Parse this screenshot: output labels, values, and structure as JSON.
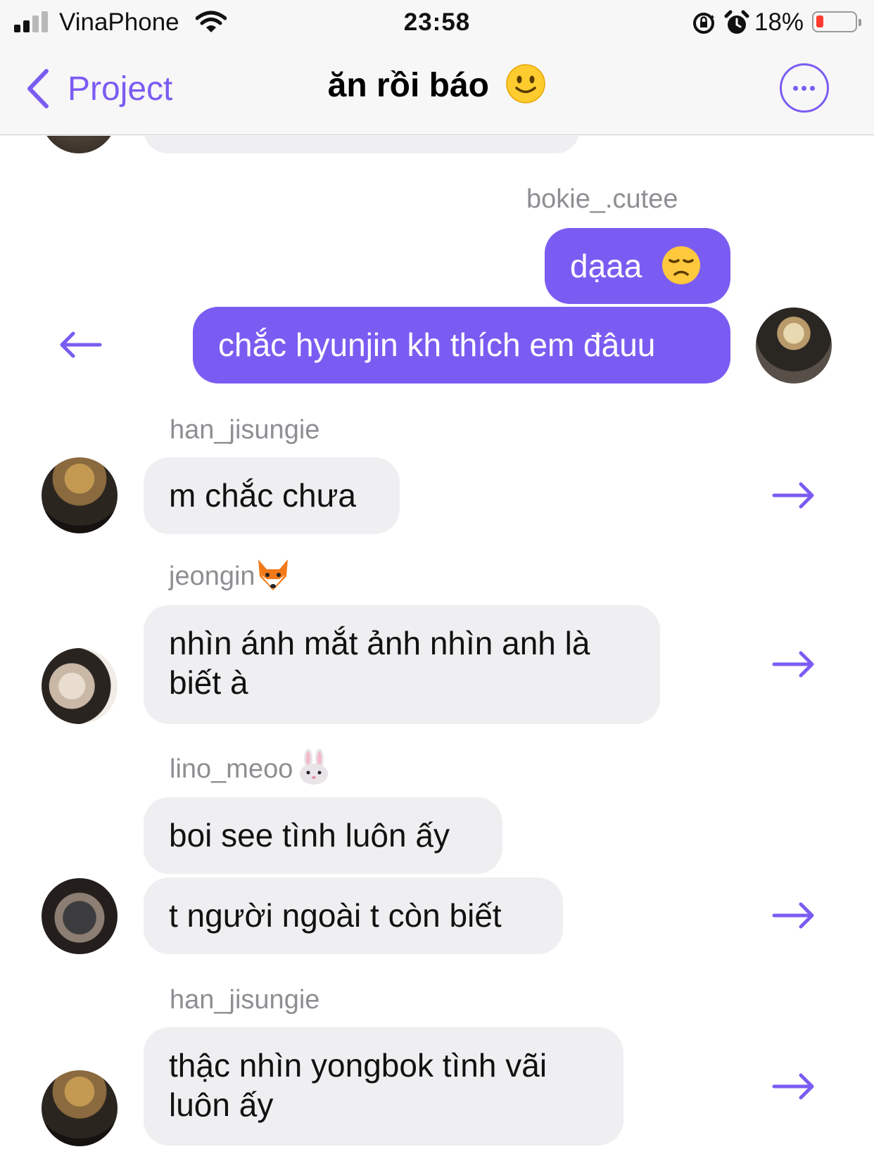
{
  "status_bar": {
    "carrier": "VinaPhone",
    "time": "23:58",
    "battery_percent": "18%",
    "battery_level": 0.18
  },
  "header": {
    "back_label": "Project",
    "title": "ăn rồi báo",
    "title_emoji": "slightly-smiling-face",
    "accent_color": "#7b5cf2"
  },
  "messages": {
    "outgoing": {
      "sender": "bokie_.cutee",
      "m1": "dạaa",
      "m1_emoji": "disappointed-face",
      "m2": "chắc hyunjin kh thích em đâuu"
    },
    "group1": {
      "sender": "han_jisungie",
      "m1": "m chắc chưa"
    },
    "group2": {
      "sender": "jeongin",
      "sender_emoji": "fox-face",
      "m1": "nhìn ánh mắt ảnh nhìn anh là biết à"
    },
    "group3": {
      "sender": "lino_meoo",
      "sender_emoji": "rabbit-face",
      "m1": "boi see tình luôn ấy",
      "m2": "t người ngoài t còn biết"
    },
    "group4": {
      "sender": "han_jisungie",
      "m1": "thậc nhìn yongbok tình vãi luôn ấy"
    }
  },
  "colors": {
    "outgoing_bubble": "#7b5cf2",
    "incoming_bubble": "#efeff1",
    "sender_name": "#8e8e93"
  }
}
